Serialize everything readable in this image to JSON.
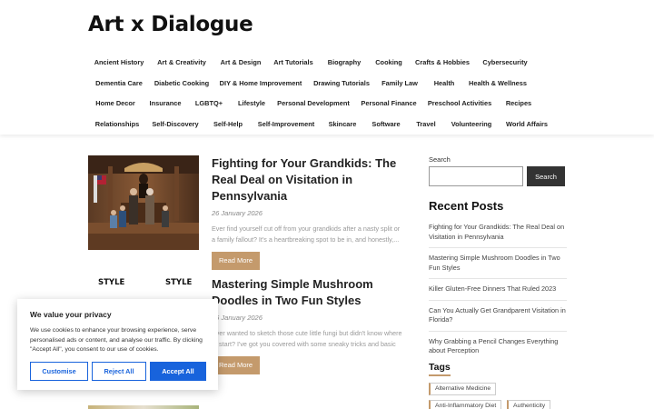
{
  "site": {
    "title": "Art x Dialogue"
  },
  "nav": {
    "rows": [
      [
        "Ancient History",
        "Art & Creativity",
        "Art & Design",
        "Art Tutorials",
        "Biography",
        "Cooking",
        "Crafts & Hobbies",
        "Cybersecurity"
      ],
      [
        "Dementia Care",
        "Diabetic Cooking",
        "DIY & Home Improvement",
        "Drawing Tutorials",
        "Family Law",
        "Health",
        "Health & Wellness"
      ],
      [
        "Home Decor",
        "Insurance",
        "LGBTQ+",
        "Lifestyle",
        "Personal Development",
        "Personal Finance",
        "Preschool Activities",
        "Recipes"
      ],
      [
        "Relationships",
        "Self-Discovery",
        "Self-Help",
        "Self-Improvement",
        "Skincare",
        "Software",
        "Travel",
        "Volunteering",
        "World Affairs"
      ]
    ]
  },
  "posts": [
    {
      "title": "Fighting for Your Grandkids: The Real Deal on Visitation in Pennsylvania",
      "date": "26 January 2026",
      "excerpt": "Ever find yourself cut off from your grandkids after a nasty split or a family fallout? It's a heartbreaking spot to be in, and honestly,...",
      "read_more": "Read More"
    },
    {
      "title": "Mastering Simple Mushroom Doodles in Two Fun Styles",
      "date": "26 January 2026",
      "excerpt": "Ever wanted to sketch those cute little fungi but didn't know where to start? I've got you covered with some sneaky tricks and basic tips...",
      "read_more": "Read More",
      "thumb_label_left": "STYLE",
      "thumb_label_right": "STYLE"
    }
  ],
  "sidebar": {
    "search_label": "Search",
    "search_placeholder": "",
    "search_button": "Search",
    "recent_title": "Recent Posts",
    "recent": [
      "Fighting for Your Grandkids: The Real Deal on Visitation in Pennsylvania",
      "Mastering Simple Mushroom Doodles in Two Fun Styles",
      "Killer Gluten-Free Dinners That Ruled 2023",
      "Can You Actually Get Grandparent Visitation in Florida?",
      "Why Grabbing a Pencil Changes Everything about Perception"
    ],
    "tags_title": "Tags",
    "tags": [
      "Alternative Medicine",
      "Anti-Inflammatory Diet",
      "Authenticity"
    ]
  },
  "cookie": {
    "title": "We value your privacy",
    "text": "We use cookies to enhance your browsing experience, serve personalised ads or content, and analyse our traffic. By clicking \"Accept All\", you consent to our use of cookies.",
    "customise": "Customise",
    "reject": "Reject All",
    "accept": "Accept All"
  },
  "colors": {
    "accent": "#c49a6c",
    "cookie_blue": "#1863dc",
    "search_button": "#333333"
  }
}
